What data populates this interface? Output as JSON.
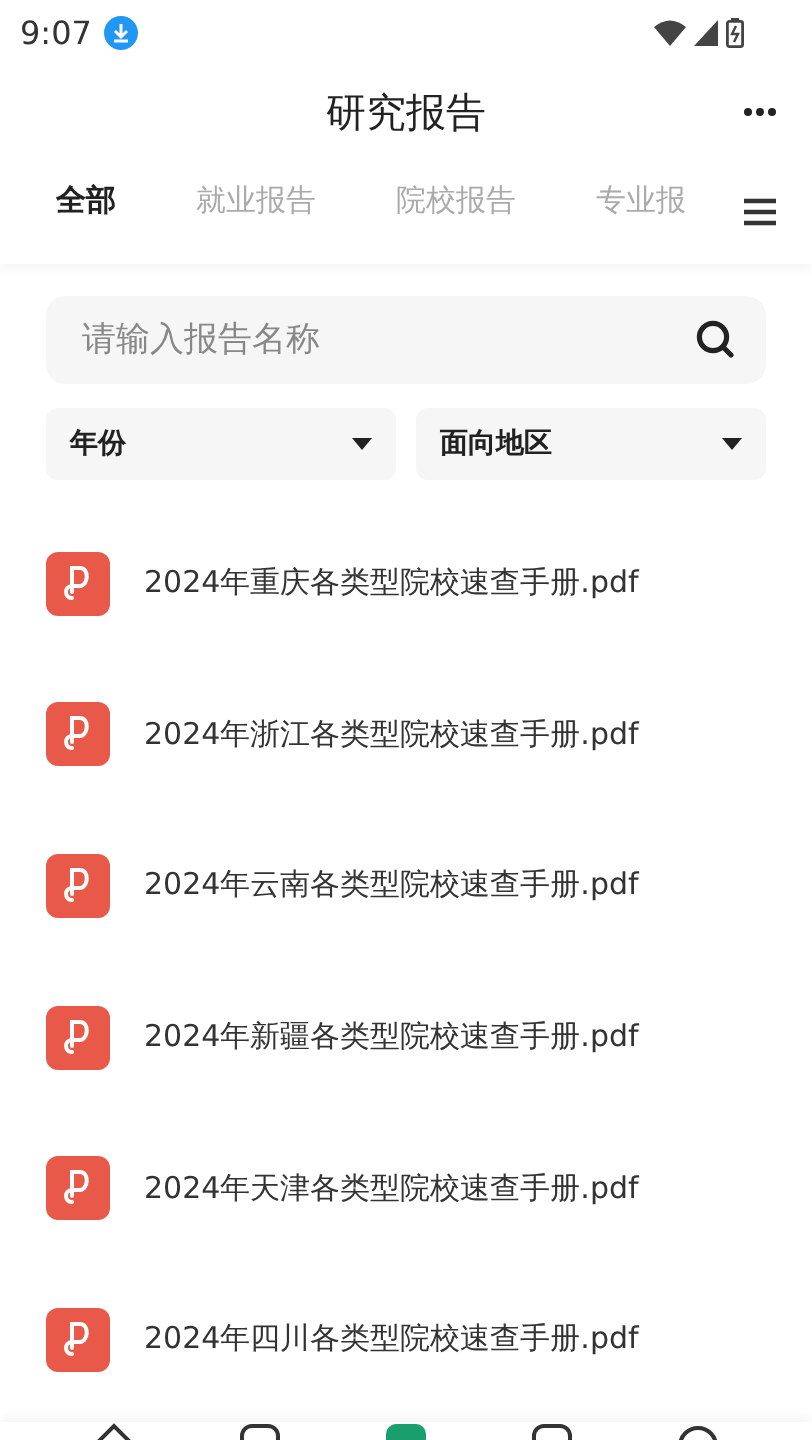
{
  "status_bar": {
    "time": "9:07"
  },
  "header": {
    "title": "研究报告"
  },
  "tabs": [
    {
      "label": "全部",
      "selected": true
    },
    {
      "label": "就业报告",
      "selected": false
    },
    {
      "label": "院校报告",
      "selected": false
    },
    {
      "label": "专业报",
      "selected": false
    }
  ],
  "search": {
    "placeholder": "请输入报告名称"
  },
  "filters": [
    {
      "label": "年份"
    },
    {
      "label": "面向地区"
    }
  ],
  "files": [
    {
      "name": "2024年重庆各类型院校速查手册.pdf"
    },
    {
      "name": "2024年浙江各类型院校速查手册.pdf"
    },
    {
      "name": "2024年云南各类型院校速查手册.pdf"
    },
    {
      "name": "2024年新疆各类型院校速查手册.pdf"
    },
    {
      "name": "2024年天津各类型院校速查手册.pdf"
    },
    {
      "name": "2024年四川各类型院校速查手册.pdf"
    }
  ],
  "bottom_nav": [
    {
      "kind": "home",
      "selected": false
    },
    {
      "kind": "square",
      "selected": false
    },
    {
      "kind": "square",
      "selected": true
    },
    {
      "kind": "square",
      "selected": false
    },
    {
      "kind": "circle",
      "selected": false
    }
  ]
}
